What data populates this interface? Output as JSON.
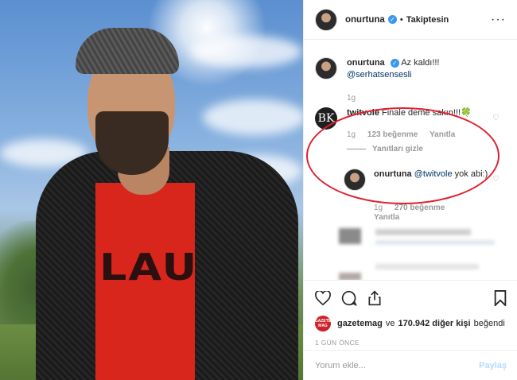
{
  "post": {
    "author": "onurtuna",
    "follow_status": "Takiptesin",
    "shirt_print": "LAU"
  },
  "comments": [
    {
      "user": "onurtuna",
      "text": "Az kaldı!!!",
      "mention": "@serhatsenseslі",
      "age": "1g"
    },
    {
      "user": "twitvole",
      "text": "Finale deme sakın!!!🍀",
      "age": "1g",
      "likes": "123 beğenme",
      "reply": "Yanıtla",
      "hide_replies": "Yanıtları gizle"
    },
    {
      "user": "onurtuna",
      "mention": "@twitvole",
      "text": "yok abi:)",
      "age": "1g",
      "likes": "270 beğenme",
      "reply": "Yanıtla"
    }
  ],
  "likes": {
    "liker": "gazetemag",
    "connector": "ve",
    "count_text": "170.942 diğer kişi",
    "suffix": "beğendi",
    "badge": "GAZETE MAG"
  },
  "timestamp": "1 GÜN ÖNCE",
  "comment_box": {
    "placeholder": "Yorum ekle...",
    "submit": "Paylaş"
  },
  "colors": {
    "accent": "#3897f0",
    "highlight_oval": "#e0212f"
  }
}
